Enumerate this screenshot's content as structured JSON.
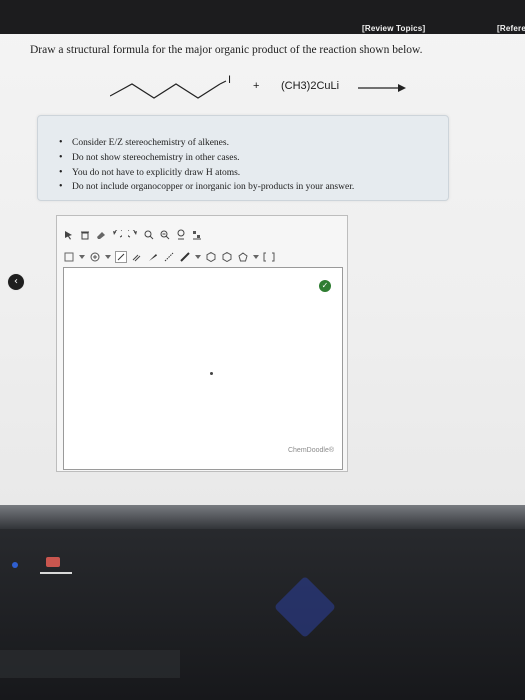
{
  "header": {
    "review_link": "[Review Topics]",
    "refer_link": "[Refere"
  },
  "question": {
    "text": "Draw a structural formula for the major organic product of the reaction shown below."
  },
  "reaction": {
    "substituent_label": "I",
    "plus": "+",
    "reagent": "(CH3)2CuLi"
  },
  "hints": [
    "Consider E/Z stereochemistry of alkenes.",
    "Do not show stereochemistry in other cases.",
    "You do not have to explicitly draw H atoms.",
    "Do not include organocopper or inorganic ion by-products in your answer."
  ],
  "editor": {
    "brand": "ChemDoodle®",
    "badge_icon": "check-icon"
  },
  "colors": {
    "badge": "#2f7d32",
    "topbar": "#1c1c1e"
  }
}
